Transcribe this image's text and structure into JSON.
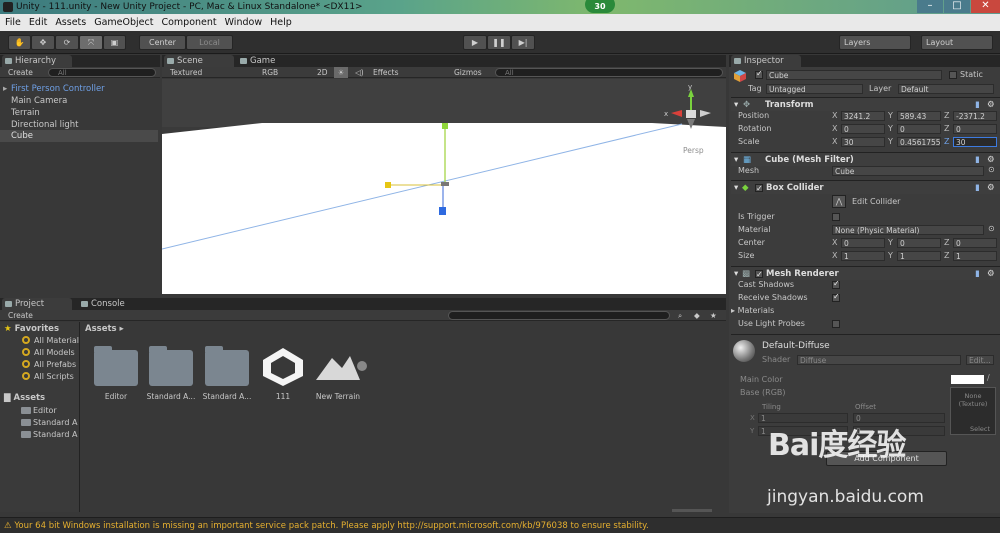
{
  "window": {
    "title": "Unity - 111.unity - New Unity Project - PC, Mac & Linux Standalone* <DX11>",
    "fps_badge": "30"
  },
  "menu": [
    "File",
    "Edit",
    "Assets",
    "GameObject",
    "Component",
    "Window",
    "Help"
  ],
  "toolbar": {
    "pivot": "Center",
    "space": "Local",
    "layers": "Layers",
    "layout": "Layout"
  },
  "hierarchy": {
    "tab": "Hierarchy",
    "create": "Create",
    "search": "All",
    "items": [
      "First Person Controller",
      "Main Camera",
      "Terrain",
      "Directional light",
      "Cube"
    ]
  },
  "scene": {
    "tab_scene": "Scene",
    "tab_game": "Game",
    "shading": "Textured",
    "render": "RGB",
    "mode2d": "2D",
    "effects": "Effects",
    "gizmos": "Gizmos",
    "search": "All",
    "persp": "Persp"
  },
  "project": {
    "tab_project": "Project",
    "tab_console": "Console",
    "create": "Create",
    "favorites": "Favorites",
    "fav_items": [
      "All Material",
      "All Models",
      "All Prefabs",
      "All Scripts"
    ],
    "assets_root": "Assets",
    "tree": [
      "Editor",
      "Standard A",
      "Standard A"
    ],
    "breadcrumb": "Assets",
    "assets": [
      "Editor",
      "Standard A...",
      "Standard A...",
      "111",
      "New Terrain"
    ]
  },
  "inspector": {
    "tab": "Inspector",
    "name": "Cube",
    "static": "Static",
    "tag_label": "Tag",
    "tag": "Untagged",
    "layer_label": "Layer",
    "layer": "Default",
    "transform": {
      "title": "Transform",
      "position_label": "Position",
      "position": [
        "3241.2",
        "589.43",
        "-2371.2"
      ],
      "rotation_label": "Rotation",
      "rotation": [
        "0",
        "0",
        "0"
      ],
      "scale_label": "Scale",
      "scale": [
        "30",
        "0.4561755",
        "30"
      ]
    },
    "mesh_filter": {
      "title": "Cube (Mesh Filter)",
      "mesh_label": "Mesh",
      "mesh": "Cube"
    },
    "box_collider": {
      "title": "Box Collider",
      "edit": "Edit Collider",
      "is_trigger_label": "Is Trigger",
      "material_label": "Material",
      "material": "None (Physic Material)",
      "center_label": "Center",
      "center": [
        "0",
        "0",
        "0"
      ],
      "size_label": "Size",
      "size": [
        "1",
        "1",
        "1"
      ]
    },
    "mesh_renderer": {
      "title": "Mesh Renderer",
      "cast_label": "Cast Shadows",
      "receive_label": "Receive Shadows",
      "materials_label": "Materials",
      "probes_label": "Use Light Probes"
    },
    "material": {
      "name": "Default-Diffuse",
      "shader_label": "Shader",
      "shader": "Diffuse",
      "edit": "Edit...",
      "main_color": "Main Color",
      "base": "Base (RGB)",
      "tiling": "Tiling",
      "offset": "Offset",
      "tex_none": "None (Texture)",
      "select": "Select",
      "tile_x": "1",
      "tile_y": "1",
      "off_x": "0",
      "off_y": "0",
      "add_component": "Add Component"
    }
  },
  "axes": {
    "x": "X",
    "y": "Y",
    "z": "Z"
  },
  "status": "Your 64 bit Windows installation is missing an important service pack patch. Please apply http://support.microsoft.com/kb/976038 to ensure stability.",
  "watermark": {
    "brand": "Bai度经验",
    "url": "jingyan.baidu.com"
  }
}
